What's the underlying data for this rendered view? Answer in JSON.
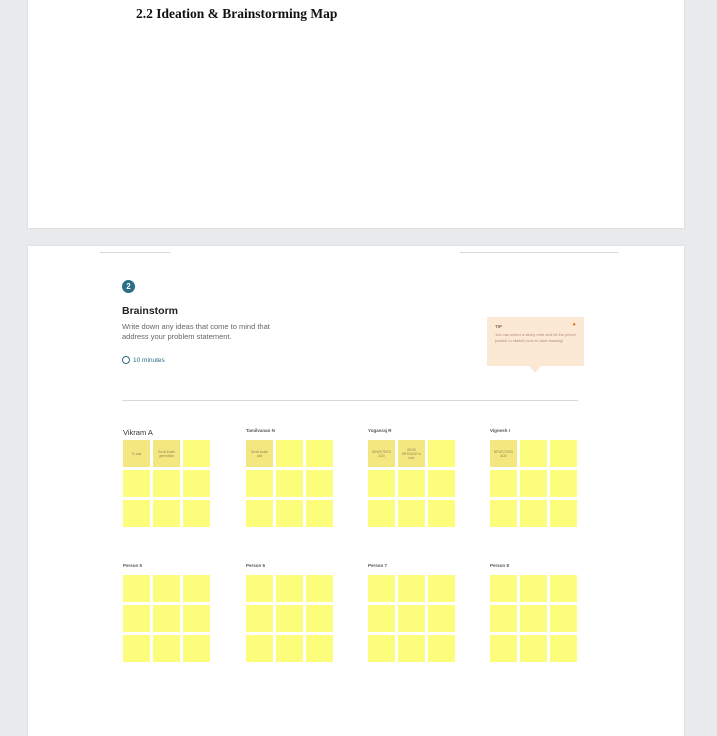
{
  "page1": {
    "heading": "2.2 Ideation & Brainstorming Map"
  },
  "brainstorm": {
    "step_number": "2",
    "title": "Brainstorm",
    "description": "Write down any ideas that come to mind that address your problem statement.",
    "timer": "10 minutes",
    "tip": {
      "label": "TIP",
      "text": "You can select a sticky note and hit the pencil [switch to sketch] icon to start drawing!"
    }
  },
  "people": [
    {
      "name": "Vikram A",
      "notes": [
        "To add",
        "Scroll inside generation",
        "",
        "",
        "",
        "",
        "",
        "",
        ""
      ]
    },
    {
      "name": "Tamilvanan N",
      "notes": [
        "Scroll inside add",
        "",
        "",
        "",
        "",
        "",
        "",
        "",
        ""
      ]
    },
    {
      "name": "Yuganraj R",
      "notes": [
        "NEWS FEED ADD",
        "SEND MESSAGE to user",
        "",
        "",
        "",
        "",
        "",
        "",
        ""
      ]
    },
    {
      "name": "Vignesh I",
      "notes": [
        "NEWS FEED ADD",
        "",
        "",
        "",
        "",
        "",
        "",
        "",
        ""
      ]
    },
    {
      "name": "Person 5",
      "notes": [
        "",
        "",
        "",
        "",
        "",
        "",
        "",
        "",
        ""
      ]
    },
    {
      "name": "Person 6",
      "notes": [
        "",
        "",
        "",
        "",
        "",
        "",
        "",
        "",
        ""
      ]
    },
    {
      "name": "Person 7",
      "notes": [
        "",
        "",
        "",
        "",
        "",
        "",
        "",
        "",
        ""
      ]
    },
    {
      "name": "Person 8",
      "notes": [
        "",
        "",
        "",
        "",
        "",
        "",
        "",
        "",
        ""
      ]
    }
  ],
  "colors": {
    "sticky": "#fdfd7c",
    "accent": "#2a6d86",
    "tip_bg": "#fbe9d5"
  }
}
